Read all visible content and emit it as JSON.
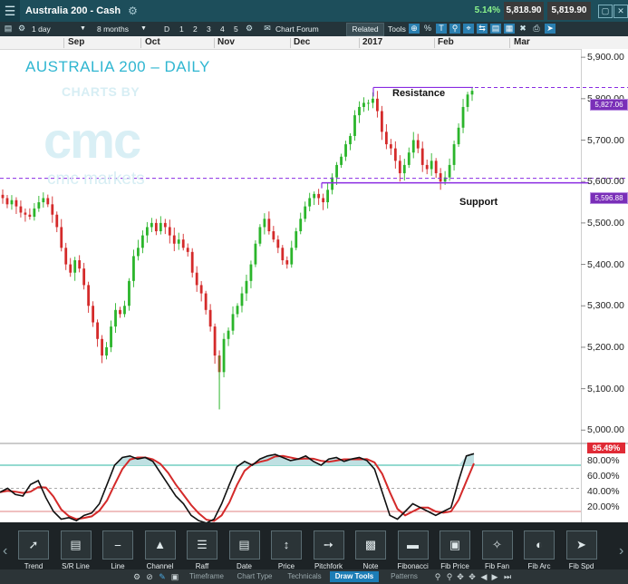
{
  "window": {
    "title": "Australia 200 - Cash",
    "change_pct": "5.14%",
    "sell_price": "5,818.90",
    "buy_price": "5,819.90"
  },
  "toolbar": {
    "interval": "1 day",
    "range": "8 months",
    "period_buttons": [
      "D",
      "1",
      "2",
      "3",
      "4",
      "5"
    ],
    "chart_forum": "Chart Forum",
    "related": "Related",
    "tools": "Tools"
  },
  "months": [
    "Sep",
    "Oct",
    "Nov",
    "Dec",
    "2017",
    "Feb",
    "Mar"
  ],
  "watermark": {
    "title": "AUSTRALIA 200 – DAILY",
    "charts_by": "CHARTS BY",
    "logo_text": "cmc",
    "brand": "cmc markets"
  },
  "annotations": {
    "resistance": "Resistance",
    "support": "Support",
    "resistance_tag": "5,827.06",
    "support_tag": "5,596.88"
  },
  "oscillator": {
    "current_value": "95.49%",
    "ticks": [
      "80.00%",
      "60.00%",
      "40.00%",
      "20.00%"
    ]
  },
  "colors": {
    "up": "#2bb52b",
    "down": "#d42a2a",
    "level": "#8a2be2",
    "osc_k": "#111111",
    "osc_d": "#d42a2a"
  },
  "chart_data": {
    "type": "candlestick",
    "title": "AUSTRALIA 200 – DAILY",
    "y_ticks": [
      5900,
      5800,
      5700,
      5600,
      5500,
      5400,
      5300,
      5200,
      5100,
      5000
    ],
    "y_tick_labels": [
      "5,900.00",
      "5,800.00",
      "5,700.00",
      "5,600.00",
      "5,500.00",
      "5,400.00",
      "5,300.00",
      "5,200.00",
      "5,100.00",
      "5,000.00"
    ],
    "ylim": [
      4970,
      5920
    ],
    "resistance_level": 5827.06,
    "support_level": 5596.88,
    "close_path": [
      5560,
      5545,
      5555,
      5540,
      5525,
      5520,
      5515,
      5535,
      5550,
      5560,
      5545,
      5520,
      5490,
      5440,
      5400,
      5380,
      5410,
      5390,
      5350,
      5300,
      5260,
      5220,
      5180,
      5200,
      5250,
      5290,
      5280,
      5300,
      5360,
      5420,
      5440,
      5470,
      5490,
      5500,
      5480,
      5500,
      5490,
      5470,
      5450,
      5460,
      5440,
      5430,
      5380,
      5350,
      5330,
      5290,
      5250,
      5180,
      5140,
      5220,
      5240,
      5280,
      5300,
      5330,
      5360,
      5400,
      5450,
      5490,
      5510,
      5480,
      5460,
      5440,
      5410,
      5400,
      5440,
      5480,
      5510,
      5540,
      5560,
      5570,
      5560,
      5550,
      5580,
      5610,
      5640,
      5660,
      5690,
      5710,
      5760,
      5780,
      5790,
      5790,
      5800,
      5770,
      5720,
      5690,
      5680,
      5650,
      5620,
      5640,
      5670,
      5700,
      5680,
      5640,
      5630,
      5650,
      5620,
      5600,
      5610,
      5640,
      5690,
      5730,
      5780,
      5810,
      5819
    ],
    "oscillator_k": [
      45,
      50,
      42,
      40,
      55,
      60,
      38,
      20,
      10,
      12,
      8,
      15,
      18,
      30,
      55,
      80,
      90,
      92,
      88,
      90,
      85,
      70,
      55,
      40,
      30,
      15,
      8,
      5,
      10,
      30,
      55,
      78,
      85,
      80,
      88,
      92,
      94,
      90,
      86,
      88,
      92,
      85,
      80,
      88,
      90,
      85,
      88,
      90,
      86,
      75,
      45,
      15,
      10,
      20,
      30,
      25,
      20,
      15,
      20,
      25,
      60,
      92,
      95
    ]
  },
  "draw_tools": [
    "Trend",
    "S/R Line",
    "Line",
    "Channel",
    "Raff",
    "Date",
    "Price",
    "Pitchfork",
    "Note",
    "Fibonacci",
    "Fib Price",
    "Fib Fan",
    "Fib Arc",
    "Fib Spd"
  ],
  "bottom_tabs": [
    "Timeframe",
    "Chart Type",
    "Technicals",
    "Draw Tools",
    "Patterns"
  ],
  "active_bottom_tab": "Draw Tools"
}
